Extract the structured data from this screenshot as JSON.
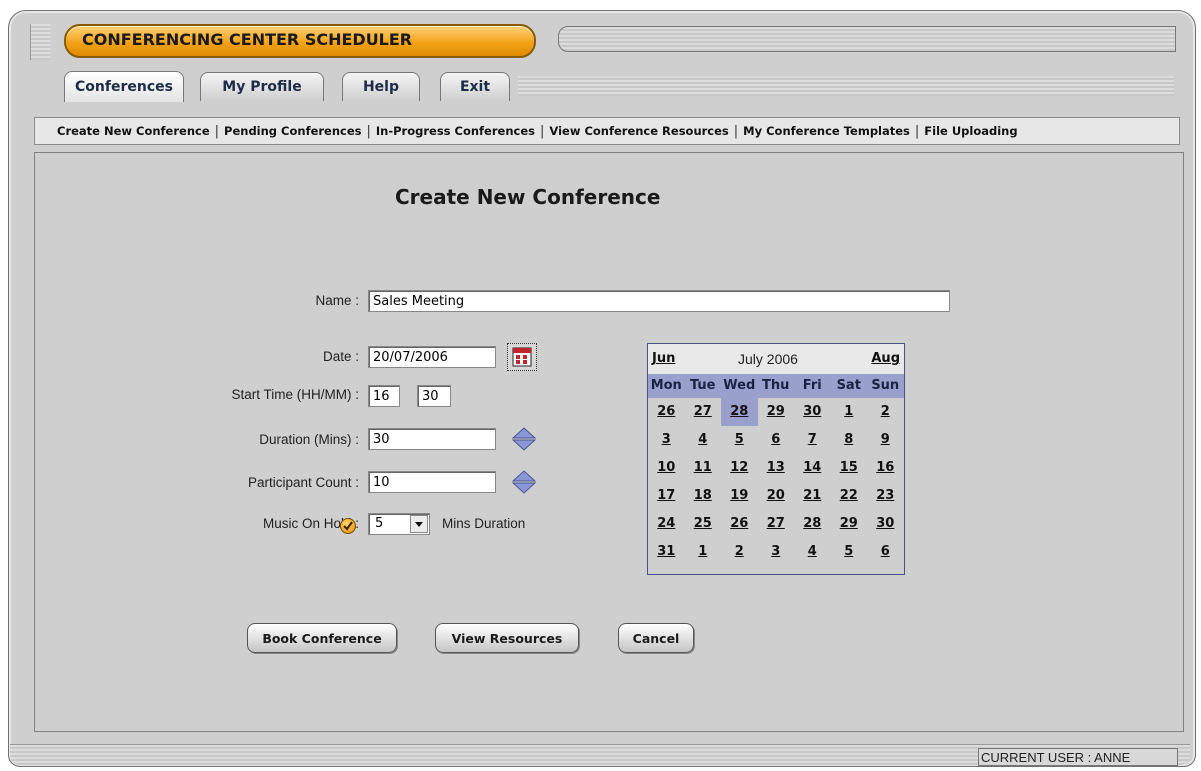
{
  "app": {
    "title": "CONFERENCING CENTER SCHEDULER"
  },
  "tabs": [
    {
      "label": "Conferences",
      "active": true
    },
    {
      "label": "My Profile",
      "active": false
    },
    {
      "label": "Help",
      "active": false
    },
    {
      "label": "Exit",
      "active": false
    }
  ],
  "subnav": [
    "Create New Conference",
    "Pending Conferences",
    "In-Progress Conferences",
    "View Conference Resources",
    "My Conference Templates",
    "File Uploading"
  ],
  "page_title": "Create New Conference",
  "form": {
    "name_label": "Name :",
    "name_value": "Sales Meeting",
    "date_label": "Date :",
    "date_value": "20/07/2006",
    "start_time_label": "Start Time (HH/MM) :",
    "start_hour": "16",
    "start_minute": "30",
    "duration_label": "Duration (Mins) :",
    "duration_value": "30",
    "participant_label": "Participant Count :",
    "participant_value": "10",
    "music_label": "Music On Hold :",
    "music_checked": true,
    "music_duration": "5",
    "music_suffix": "Mins Duration"
  },
  "calendar": {
    "prev": "Jun",
    "month": "July 2006",
    "next": "Aug",
    "weekdays": [
      "Mon",
      "Tue",
      "Wed",
      "Thu",
      "Fri",
      "Sat",
      "Sun"
    ],
    "weeks": [
      [
        "26",
        "27",
        "28",
        "29",
        "30",
        "1",
        "2"
      ],
      [
        "3",
        "4",
        "5",
        "6",
        "7",
        "8",
        "9"
      ],
      [
        "10",
        "11",
        "12",
        "13",
        "14",
        "15",
        "16"
      ],
      [
        "17",
        "18",
        "19",
        "20",
        "21",
        "22",
        "23"
      ],
      [
        "24",
        "25",
        "26",
        "27",
        "28",
        "29",
        "30"
      ],
      [
        "31",
        "1",
        "2",
        "3",
        "4",
        "5",
        "6"
      ]
    ],
    "selected": {
      "week": 0,
      "day": 2
    }
  },
  "buttons": {
    "book": "Book Conference",
    "resources": "View Resources",
    "cancel": "Cancel"
  },
  "status": {
    "current_user": "CURRENT USER : ANNE"
  },
  "colors": {
    "accent": "#f3a319",
    "calendar_header": "#9aa0cc"
  }
}
